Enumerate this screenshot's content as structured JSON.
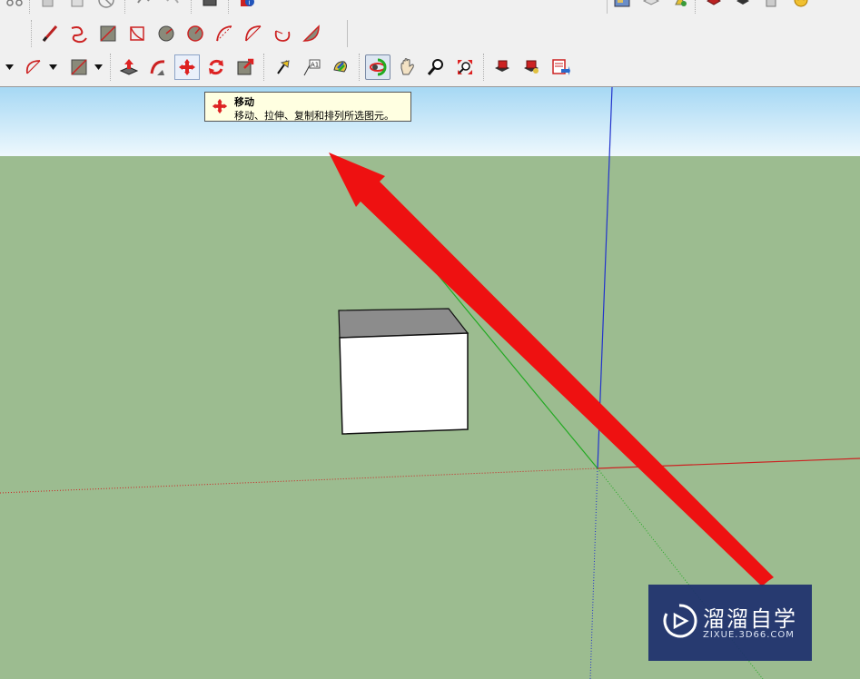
{
  "tooltip": {
    "title": "移动",
    "description": "移动、拉伸、复制和排列所选图元。"
  },
  "watermark": {
    "brand": "溜溜自学",
    "url": "ZIXUE.3D66.COM"
  },
  "toolbar": {
    "row1_left": [
      "select-icon",
      "paint-icon",
      "eraser-icon",
      "no-entry-icon",
      "undo-icon",
      "redo-icon",
      "book-icon",
      "info-icon"
    ],
    "row1_right": [
      "map-icon",
      "layer-icon",
      "scene-icon",
      "component-red-icon",
      "upload-icon",
      "document-icon",
      "face-icon"
    ],
    "row2_drawing": [
      "pencil-icon",
      "freehand-icon",
      "rectangle-icon",
      "rotated-rectangle-icon",
      "circle-icon",
      "polygon-icon",
      "arc-icon",
      "two-point-arc-icon",
      "three-point-arc-icon",
      "pie-icon"
    ],
    "row3_tools": [
      "arc-dropdown-icon",
      "shape-dropdown-icon",
      "push-pull-icon",
      "follow-me-icon",
      "move-icon",
      "rotate-icon",
      "scale-icon",
      "tape-measure-icon",
      "text-icon",
      "paint-bucket-icon",
      "orbit-icon",
      "pan-icon",
      "zoom-icon",
      "zoom-extents-icon",
      "warehouse-icon",
      "extension-warehouse-icon",
      "send-to-layout-icon"
    ]
  },
  "colors": {
    "sky_top": "#a6d8f4",
    "ground": "#9cbc90",
    "arrow": "#ee1111",
    "axis_red": "#cc2222",
    "axis_green": "#22aa22",
    "axis_blue": "#2233cc",
    "watermark_bg": "#1e306e"
  }
}
